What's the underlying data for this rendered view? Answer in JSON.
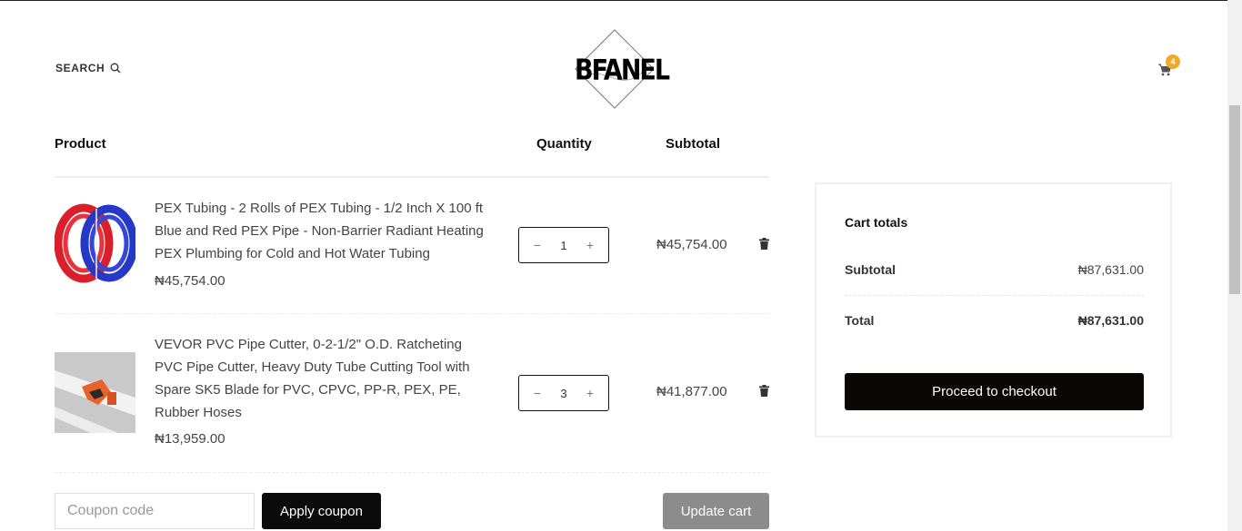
{
  "header": {
    "search_label": "SEARCH",
    "logo_text": "BFANEL",
    "cart_count": "4",
    "icons": {
      "search": "search-icon",
      "cart": "cart-icon"
    }
  },
  "table": {
    "columns": {
      "product": "Product",
      "quantity": "Quantity",
      "subtotal": "Subtotal"
    }
  },
  "items": [
    {
      "name": "PEX Tubing - 2 Rolls of PEX Tubing - 1/2 Inch X 100 ft Blue and Red PEX Pipe - Non-Barrier Radiant Heating PEX Plumbing for Cold and Hot Water Tubing",
      "price": "₦45,754.00",
      "quantity": "1",
      "line_total": "₦45,754.00"
    },
    {
      "name": "VEVOR PVC Pipe Cutter, 0-2-1/2\" O.D. Ratcheting PVC Pipe Cutter, Heavy Duty Tube Cutting Tool with Spare SK5 Blade for PVC, CPVC, PP-R, PEX, PE, Rubber Hoses",
      "price": "₦13,959.00",
      "quantity": "3",
      "line_total": "₦41,877.00"
    }
  ],
  "qty_controls": {
    "minus": "−",
    "plus": "+"
  },
  "actions": {
    "coupon_placeholder": "Coupon code",
    "apply_coupon": "Apply coupon",
    "update_cart": "Update cart"
  },
  "totals": {
    "title": "Cart totals",
    "subtotal_label": "Subtotal",
    "subtotal_value": "₦87,631.00",
    "total_label": "Total",
    "total_value": "₦87,631.00",
    "checkout_label": "Proceed to checkout"
  },
  "colors": {
    "primary_button": "#0b0b0b",
    "update_button": "#8c8c8c",
    "cart_badge": "#f0a92b"
  }
}
